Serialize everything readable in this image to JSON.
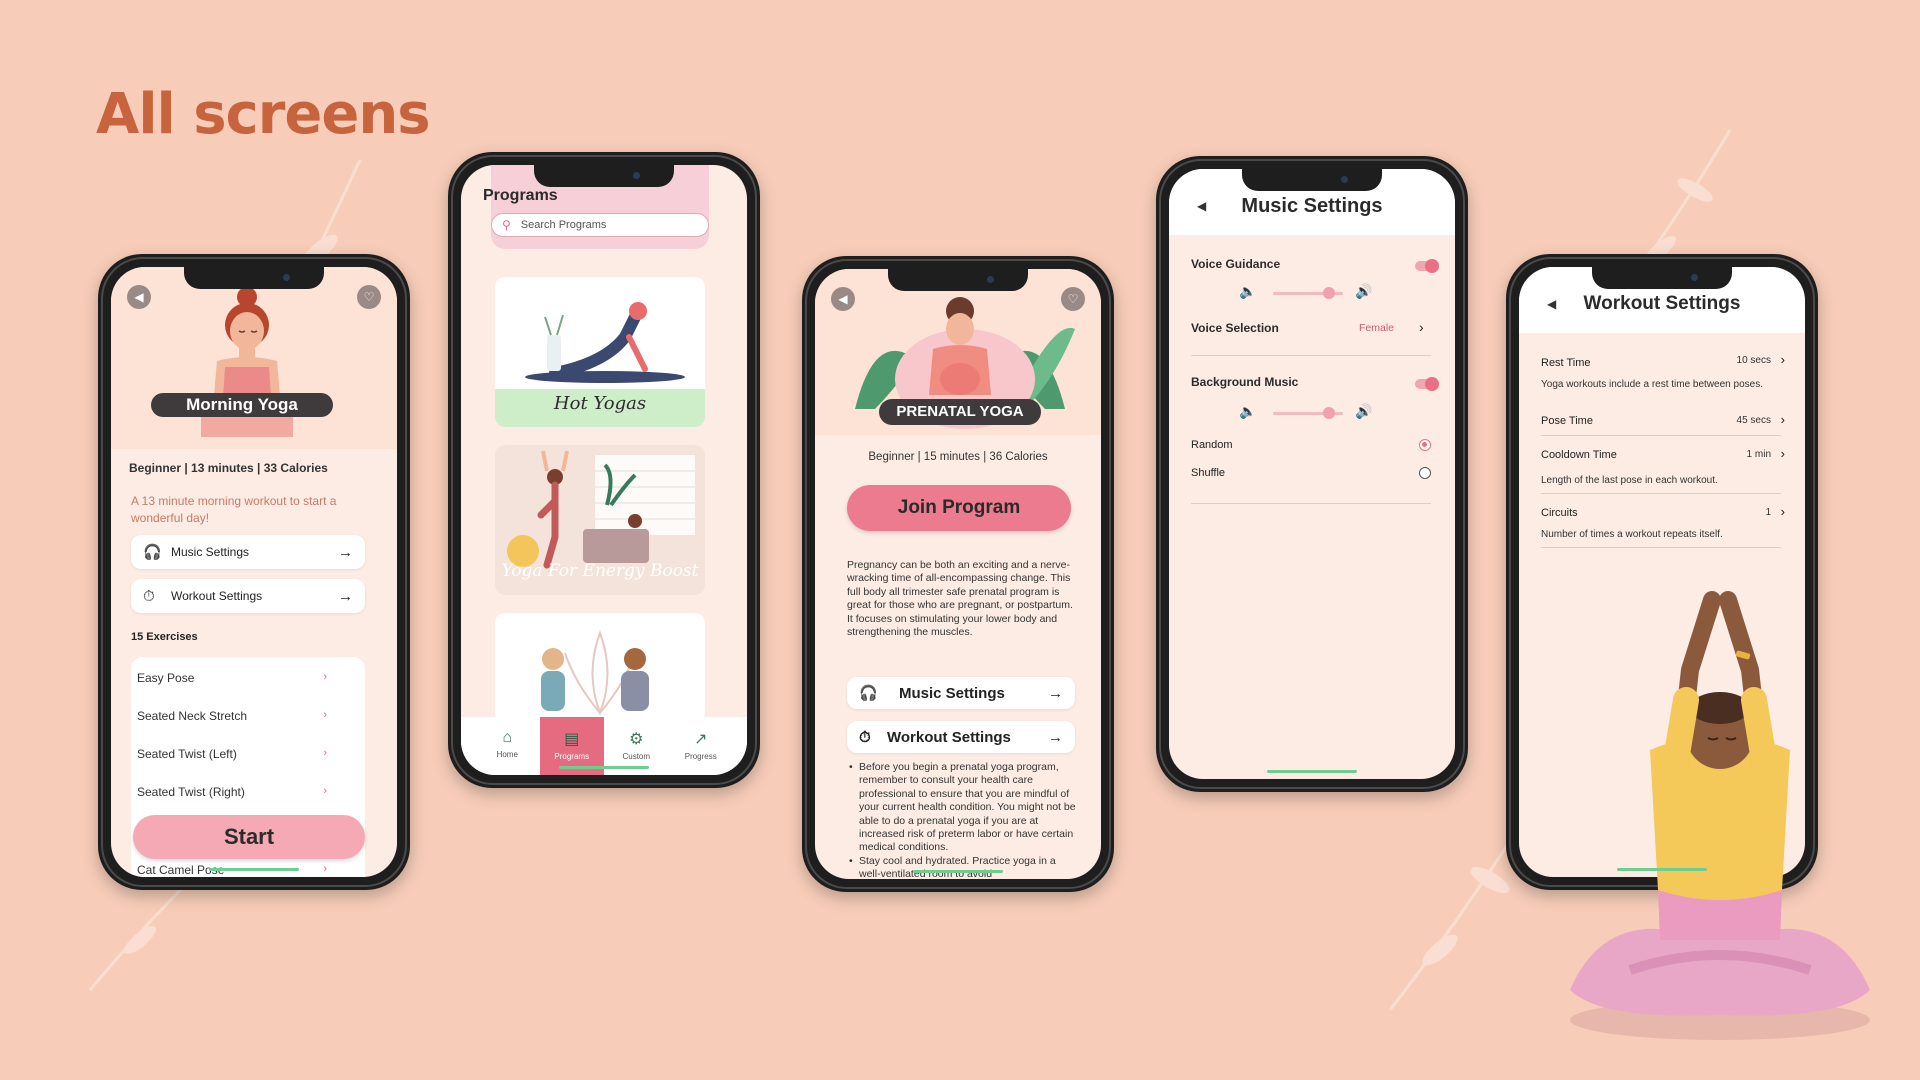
{
  "heading": "All screens",
  "colors": {
    "background": "#f7cdb9",
    "heading": "#c8643d",
    "accent": "#ec7b8f"
  },
  "screen1": {
    "hero_title": "Morning Yoga",
    "meta": "Beginner | 13 minutes | 33 Calories",
    "description": "A 13 minute morning workout to start a wonderful day!",
    "music_settings": "Music Settings",
    "workout_settings": "Workout Settings",
    "exercises_count": "15 Exercises",
    "exercises": [
      "Easy Pose",
      "Seated Neck Stretch",
      "Seated Twist (Left)",
      "Seated Twist (Right)",
      "Cat Camel Pose"
    ],
    "start_label": "Start"
  },
  "screen2": {
    "title": "Programs",
    "search_placeholder": "Search Programs",
    "cards": [
      "Hot Yogas",
      "Yoga For Energy Boost"
    ],
    "tabs": [
      "Home",
      "Programs",
      "Custom",
      "Progress"
    ]
  },
  "screen3": {
    "hero_title": "PRENATAL YOGA",
    "meta": "Beginner | 15 minutes | 36 Calories",
    "join_label": "Join Program",
    "description": "Pregnancy can be both an exciting and a nerve-wracking time of all-encompassing change. This full body all trimester safe prenatal program is great for those who are pregnant, or postpartum. It focuses on stimulating your lower body and strengthening the muscles.",
    "music_settings": "Music Settings",
    "workout_settings": "Workout Settings",
    "bullets": [
      "Before you begin a prenatal yoga program, remember to consult your health care professional to ensure that you are mindful of your current health condition. You might not be able to do a prenatal yoga if you are at increased risk of preterm labor or have certain medical conditions.",
      "Stay cool and hydrated. Practice yoga in a well-ventilated room to avoid"
    ]
  },
  "screen4": {
    "title": "Music Settings",
    "voice_guidance": "Voice Guidance",
    "voice_selection": "Voice Selection",
    "voice_value": "Female",
    "background_music": "Background Music",
    "random": "Random",
    "shuffle": "Shuffle"
  },
  "screen5": {
    "title": "Workout Settings",
    "rest_time": "Rest Time",
    "rest_value": "10 secs",
    "rest_desc": "Yoga workouts include a rest time between poses.",
    "pose_time": "Pose Time",
    "pose_value": "45 secs",
    "cooldown_time": "Cooldown Time",
    "cooldown_value": "1 min",
    "cooldown_desc": "Length of the last pose in each workout.",
    "circuits": "Circuits",
    "circuits_value": "1",
    "circuits_desc": "Number of times a workout repeats itself."
  }
}
